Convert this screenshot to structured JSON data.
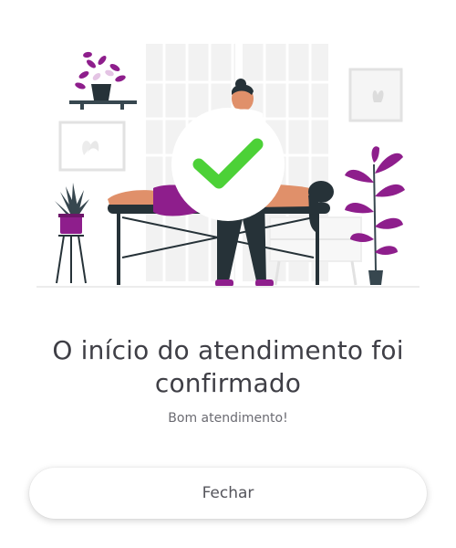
{
  "dialog": {
    "title": "O início do atendimento foi confirmado",
    "subtitle": "Bom atendimento!",
    "close_label": "Fechar"
  },
  "colors": {
    "accent_purple": "#8e1e8c",
    "check_green": "#4cd137",
    "title_text": "#3f3f46",
    "subtitle_text": "#6b6b72"
  },
  "icons": {
    "confirmation": "check-icon"
  }
}
